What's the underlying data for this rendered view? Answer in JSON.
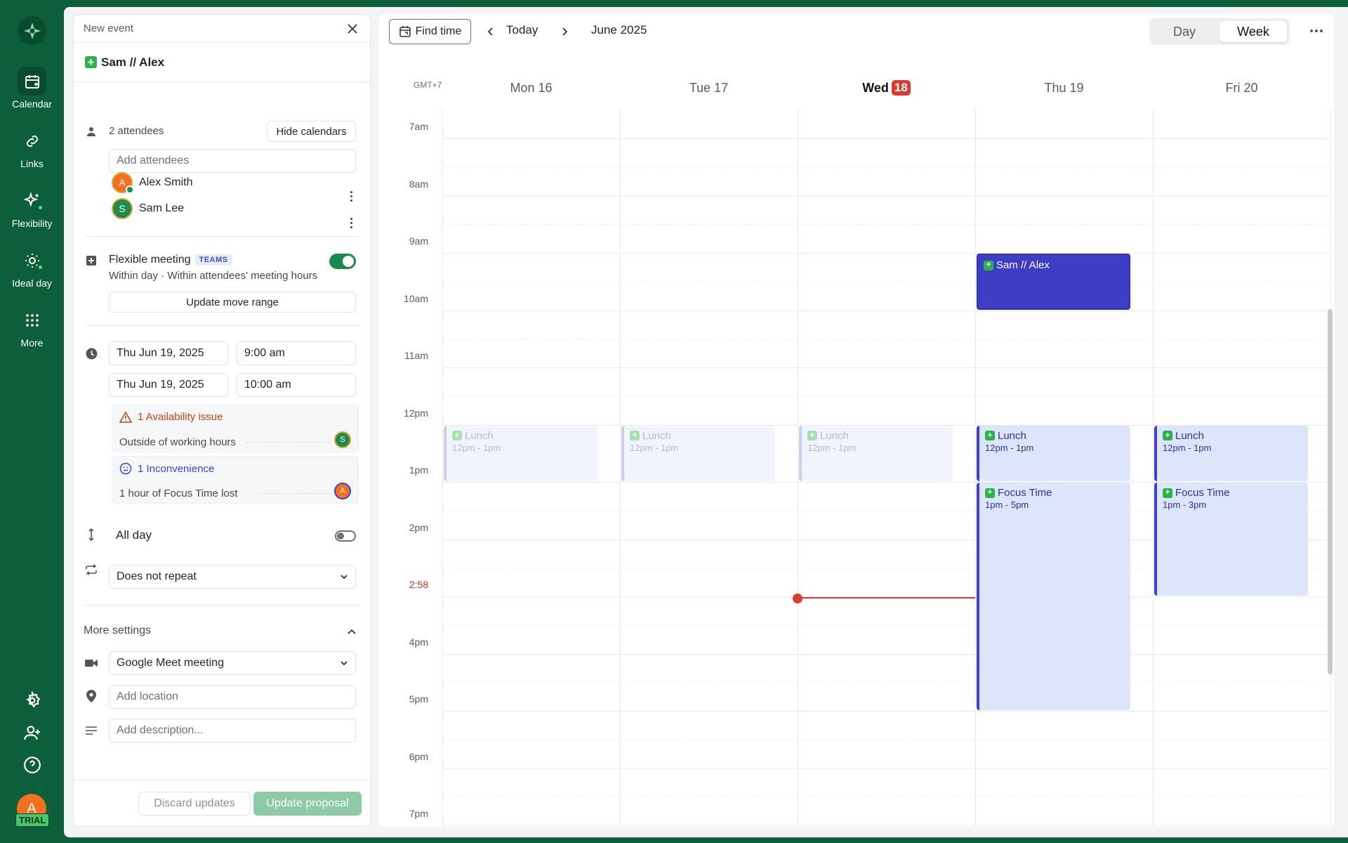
{
  "rail": {
    "items": [
      {
        "label": "Calendar",
        "icon": "calendar-icon",
        "active": true
      },
      {
        "label": "Links",
        "icon": "link-icon"
      },
      {
        "label": "Flexibility",
        "icon": "sparkle-icon"
      },
      {
        "label": "Ideal day",
        "icon": "sun-icon"
      },
      {
        "label": "More",
        "icon": "grid-icon"
      }
    ],
    "user_initial": "A",
    "trial_label": "TRIAL"
  },
  "panel": {
    "header": "New event",
    "event_title": "Sam // Alex",
    "attendees_count": "2 attendees",
    "hide_calendars": "Hide calendars",
    "add_attendees_placeholder": "Add attendees",
    "attendees": [
      {
        "name": "Alex Smith",
        "initial": "A",
        "color": "#f2701e"
      },
      {
        "name": "Sam Lee",
        "initial": "S",
        "color": "#1c8c4a"
      }
    ],
    "flexible": {
      "label": "Flexible meeting",
      "badge": "TEAMS",
      "desc": "Within day · Within attendees' meeting hours",
      "button": "Update move range",
      "enabled": true
    },
    "start_date": "Thu Jun 19, 2025",
    "start_time": "9:00 am",
    "end_date": "Thu Jun 19, 2025",
    "end_time": "10:00 am",
    "availability": {
      "title": "1 Availability issue",
      "detail": "Outside of working hours",
      "initial": "S"
    },
    "inconvenience": {
      "title": "1 Inconvenience",
      "detail": "1 hour of Focus Time lost",
      "initial": "A"
    },
    "all_day_label": "All day",
    "all_day": false,
    "repeat": "Does not repeat",
    "more_settings": "More settings",
    "conference": "Google Meet meeting",
    "location_placeholder": "Add location",
    "description_placeholder": "Add description...",
    "discard": "Discard updates",
    "update": "Update proposal"
  },
  "calendar": {
    "find_time": "Find time",
    "today": "Today",
    "month": "June 2025",
    "views": [
      "Day",
      "Week"
    ],
    "active_view": "Week",
    "timezone": "GMT+7",
    "days": [
      {
        "label": "Mon 16"
      },
      {
        "label": "Tue 17"
      },
      {
        "label": "Wed",
        "num": "18",
        "today": true
      },
      {
        "label": "Thu 19"
      },
      {
        "label": "Fri 20"
      }
    ],
    "hours": [
      "7am",
      "8am",
      "9am",
      "10am",
      "11am",
      "12pm",
      "1pm",
      "2pm",
      "2:58",
      "4pm",
      "5pm",
      "6pm",
      "7pm"
    ],
    "now_label": "2:58",
    "events": [
      {
        "day": 0,
        "title": "Lunch",
        "time": "12pm - 1pm",
        "start": 12,
        "end": 13,
        "style": "faded"
      },
      {
        "day": 1,
        "title": "Lunch",
        "time": "12pm - 1pm",
        "start": 12,
        "end": 13,
        "style": "faded"
      },
      {
        "day": 2,
        "title": "Lunch",
        "time": "12pm - 1pm",
        "start": 12,
        "end": 13,
        "style": "faded"
      },
      {
        "day": 3,
        "title": "Sam // Alex",
        "time": "",
        "start": 9,
        "end": 10,
        "style": "dark"
      },
      {
        "day": 3,
        "title": "Lunch",
        "time": "12pm - 1pm",
        "start": 12,
        "end": 13,
        "style": "light"
      },
      {
        "day": 3,
        "title": "Focus Time",
        "time": "1pm - 5pm",
        "start": 13,
        "end": 17,
        "style": "light"
      },
      {
        "day": 4,
        "title": "Lunch",
        "time": "12pm - 1pm",
        "start": 12,
        "end": 13,
        "style": "light"
      },
      {
        "day": 4,
        "title": "Focus Time",
        "time": "1pm - 3pm",
        "start": 13,
        "end": 15,
        "style": "light"
      }
    ]
  }
}
